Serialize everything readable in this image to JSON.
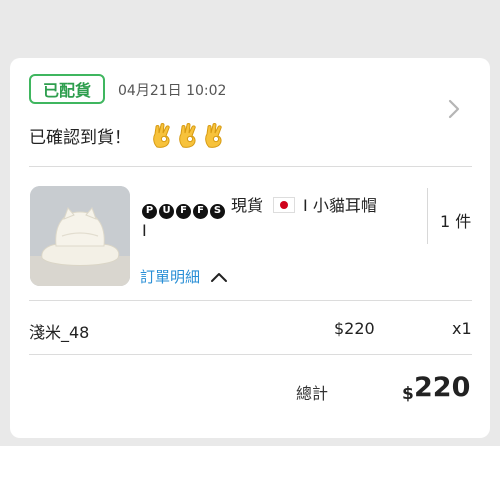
{
  "order": {
    "status": "已配貨",
    "timestamp": "04月21日 10:02",
    "message": "已確認到貨！",
    "emoji": "ok-hand-icon"
  },
  "item": {
    "brand_letters": [
      "P",
      "U",
      "F",
      "F",
      "S"
    ],
    "title_prefix": "現貨",
    "title_main": "I 小貓耳帽",
    "title_cont": "I",
    "details_link": "訂單明細",
    "quantity": "1 件"
  },
  "line": {
    "variant": "淺米_48",
    "price": "$220",
    "qty": "x1"
  },
  "total": {
    "label": "總計",
    "currency": "$",
    "amount": "220"
  },
  "colors": {
    "status_green": "#3fb65f",
    "link_blue": "#2a8fd6"
  }
}
